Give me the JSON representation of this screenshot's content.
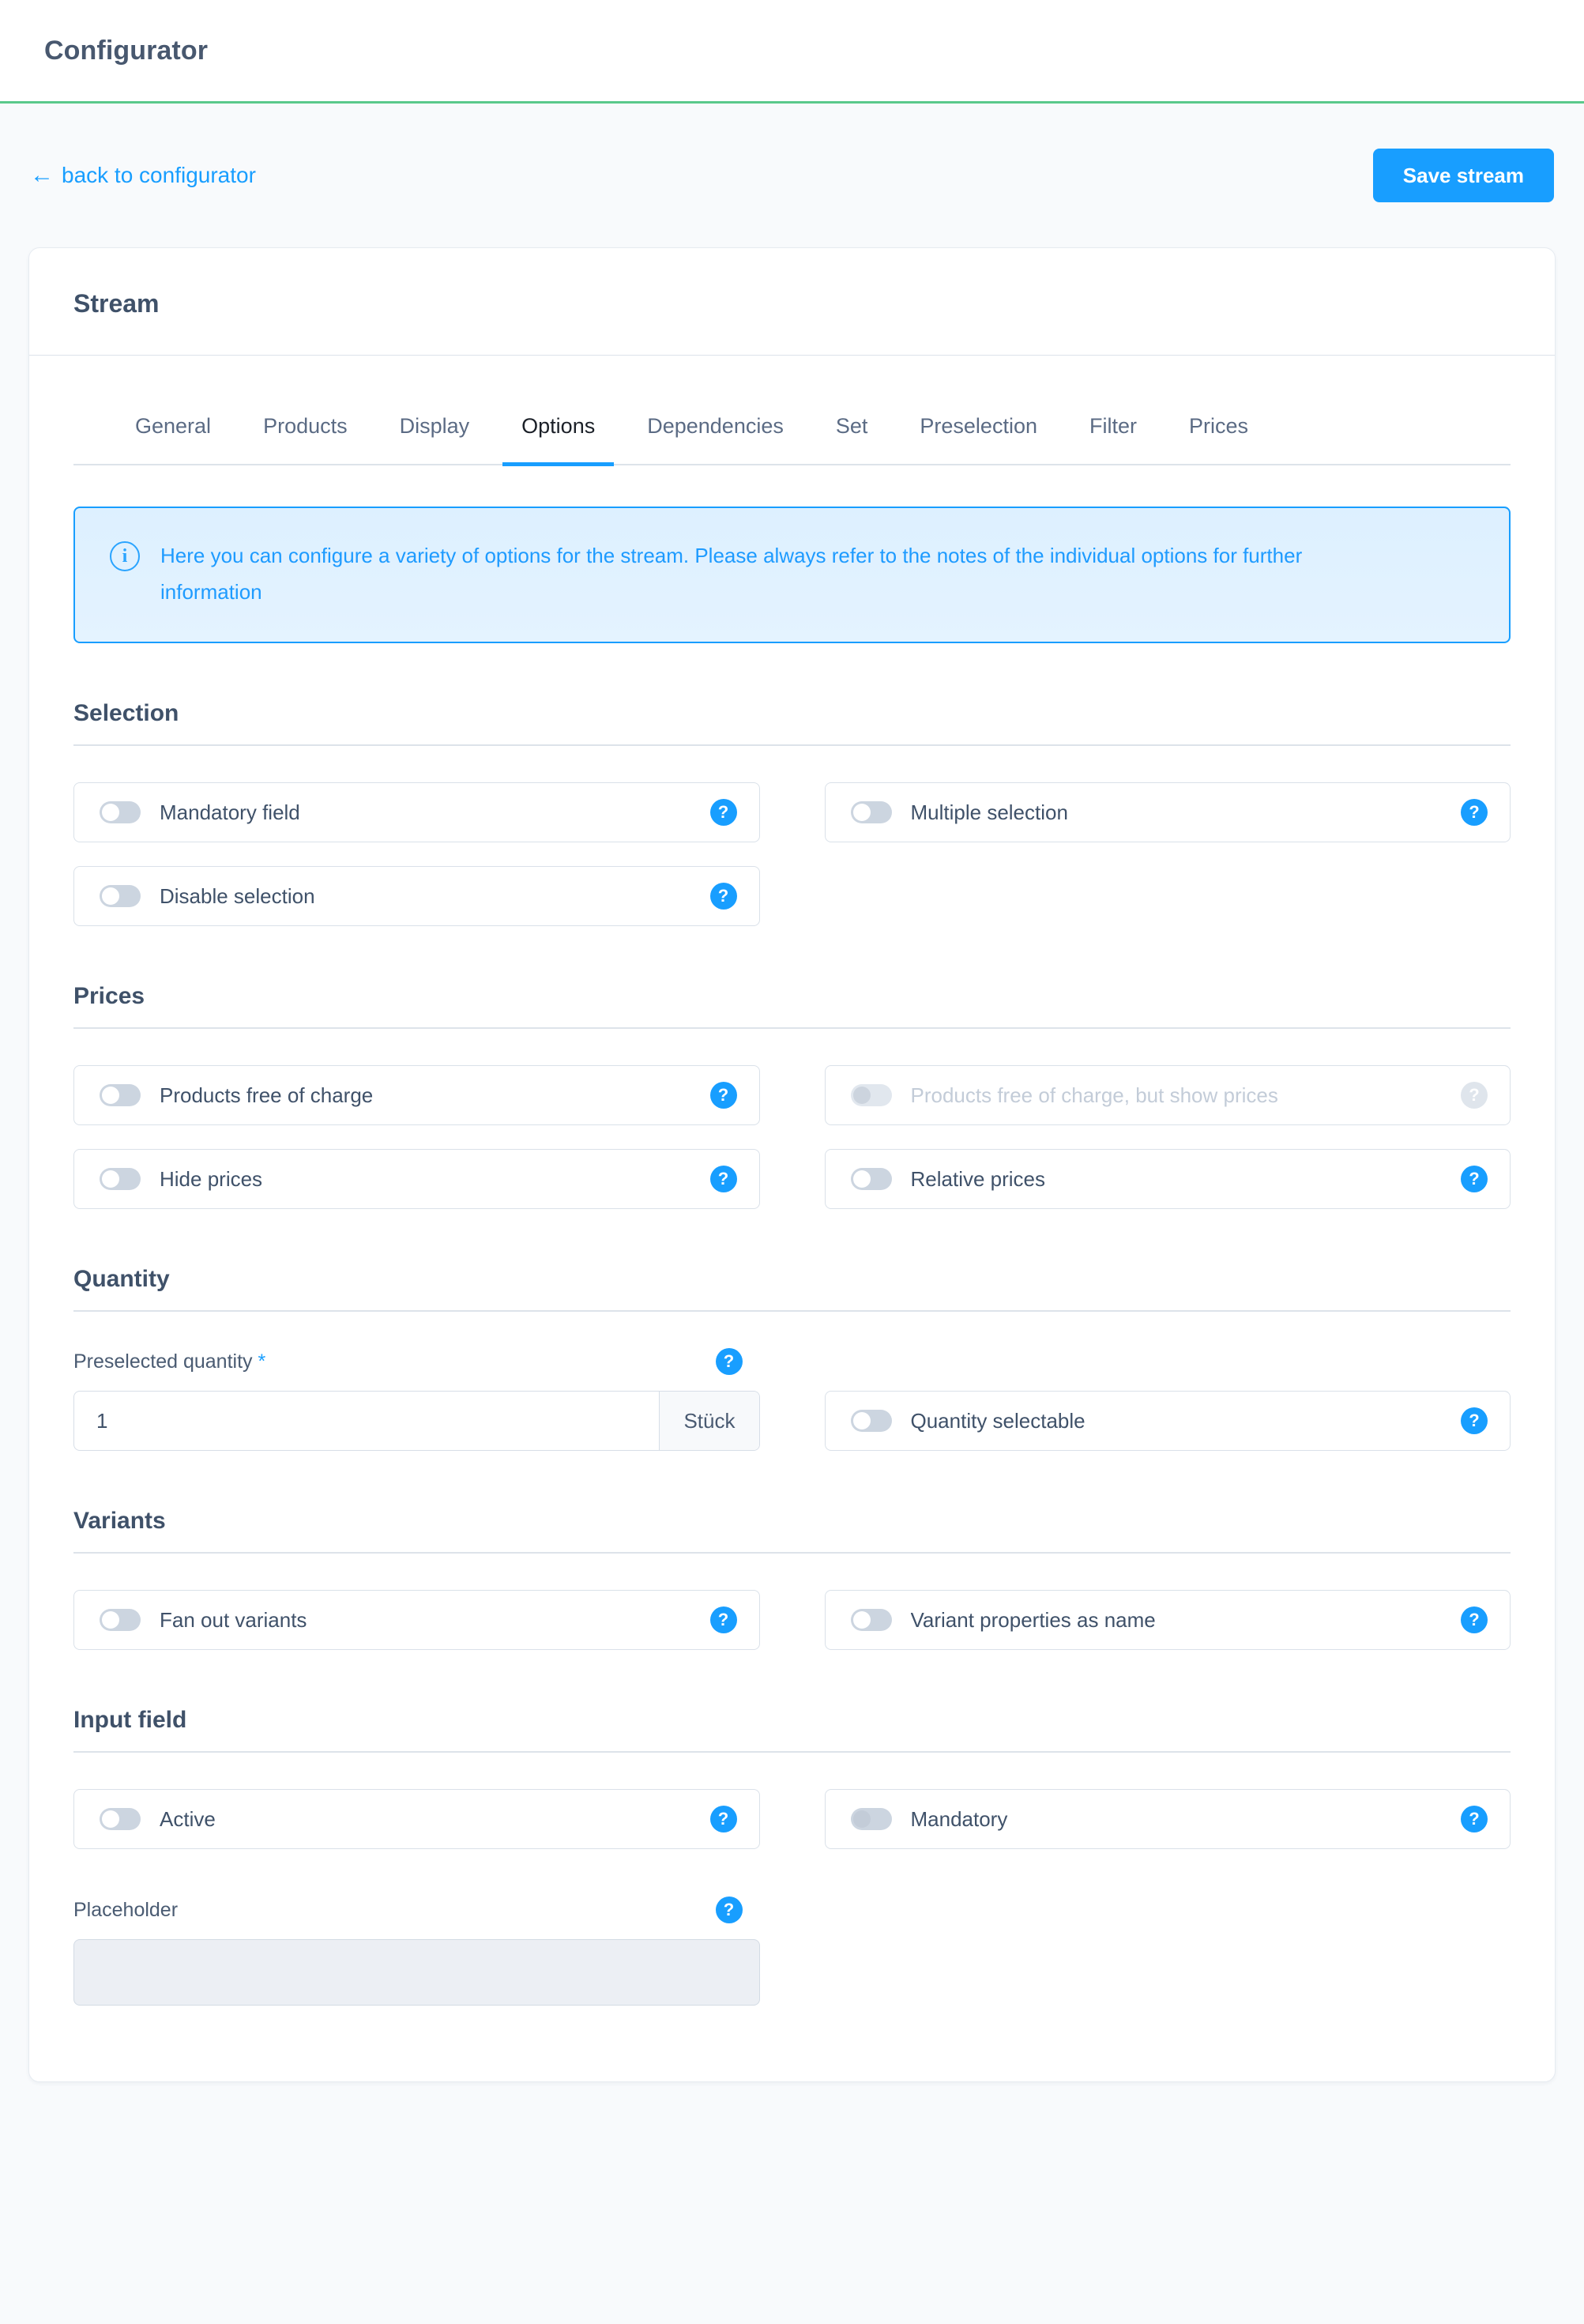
{
  "app": {
    "title": "Configurator",
    "accent_green": "#5ac98b",
    "accent_blue": "#189eff"
  },
  "toolbar": {
    "back_arrow": "←",
    "back_label": "back to configurator",
    "save_label": "Save stream"
  },
  "card": {
    "title": "Stream"
  },
  "tabs": [
    {
      "label": "General",
      "active": false
    },
    {
      "label": "Products",
      "active": false
    },
    {
      "label": "Display",
      "active": false
    },
    {
      "label": "Options",
      "active": true
    },
    {
      "label": "Dependencies",
      "active": false
    },
    {
      "label": "Set",
      "active": false
    },
    {
      "label": "Preselection",
      "active": false
    },
    {
      "label": "Filter",
      "active": false
    },
    {
      "label": "Prices",
      "active": false
    }
  ],
  "alert": {
    "icon": "info-icon",
    "glyph": "i",
    "text": "Here you can configure a variety of options for the stream. Please always refer to the notes of the individual options for further information"
  },
  "help_glyph": "?",
  "sections": {
    "selection": {
      "title": "Selection",
      "options": [
        {
          "label": "Mandatory field",
          "on": false,
          "disabled": false
        },
        {
          "label": "Multiple selection",
          "on": false,
          "disabled": false
        },
        {
          "label": "Disable selection",
          "on": false,
          "disabled": false
        }
      ]
    },
    "prices": {
      "title": "Prices",
      "options": [
        {
          "label": "Products free of charge",
          "on": false,
          "disabled": false
        },
        {
          "label": "Products free of charge, but show prices",
          "on": false,
          "disabled": true
        },
        {
          "label": "Hide prices",
          "on": false,
          "disabled": false
        },
        {
          "label": "Relative prices",
          "on": false,
          "disabled": false
        }
      ]
    },
    "quantity": {
      "title": "Quantity",
      "preselected": {
        "label": "Preselected quantity",
        "required_mark": "*",
        "value": "1",
        "unit": "Stück"
      },
      "options": [
        {
          "label": "Quantity selectable",
          "on": false,
          "disabled": false
        }
      ]
    },
    "variants": {
      "title": "Variants",
      "options": [
        {
          "label": "Fan out variants",
          "on": false,
          "disabled": false
        },
        {
          "label": "Variant properties as name",
          "on": false,
          "disabled": false
        }
      ]
    },
    "input_field": {
      "title": "Input field",
      "options": [
        {
          "label": "Active",
          "on": false,
          "disabled": false
        },
        {
          "label": "Mandatory",
          "on": false,
          "disabled": false,
          "knob_grey": true
        }
      ],
      "placeholder": {
        "label": "Placeholder",
        "value": "",
        "placeholder": ""
      }
    }
  }
}
